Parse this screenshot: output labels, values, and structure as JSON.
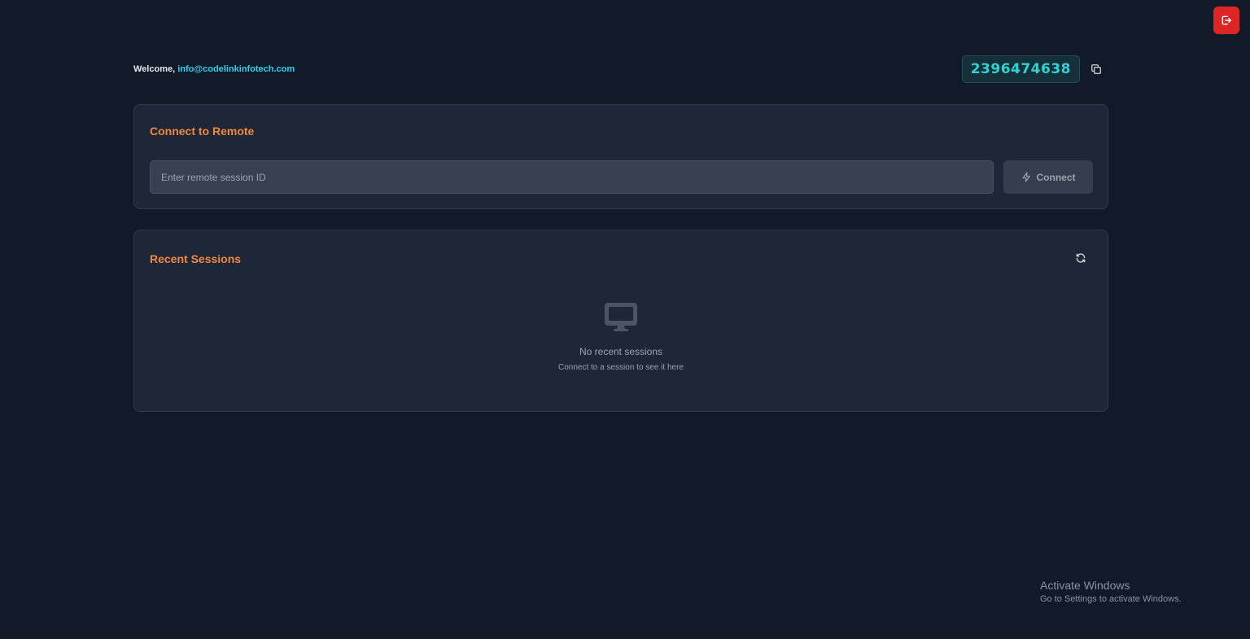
{
  "header": {
    "welcome_prefix": "Welcome,",
    "email": "info@codelinkinfotech.com",
    "session_id": "2396474638"
  },
  "icons": {
    "logout": "logout-icon",
    "copy": "copy-icon",
    "connect": "lightning-icon",
    "refresh": "refresh-icon",
    "monitor": "monitor-icon"
  },
  "colors": {
    "accent": "#f0883e",
    "id_text": "#2dd4d4",
    "email": "#22d3ee",
    "logout": "#dc2626",
    "background": "#121928"
  },
  "connect_card": {
    "title": "Connect to Remote",
    "input_placeholder": "Enter remote session ID",
    "input_value": "",
    "button_label": "Connect"
  },
  "recent_card": {
    "title": "Recent Sessions",
    "empty_title": "No recent sessions",
    "empty_subtitle": "Connect to a session to see it here"
  },
  "watermark": {
    "title": "Activate Windows",
    "subtitle": "Go to Settings to activate Windows."
  }
}
